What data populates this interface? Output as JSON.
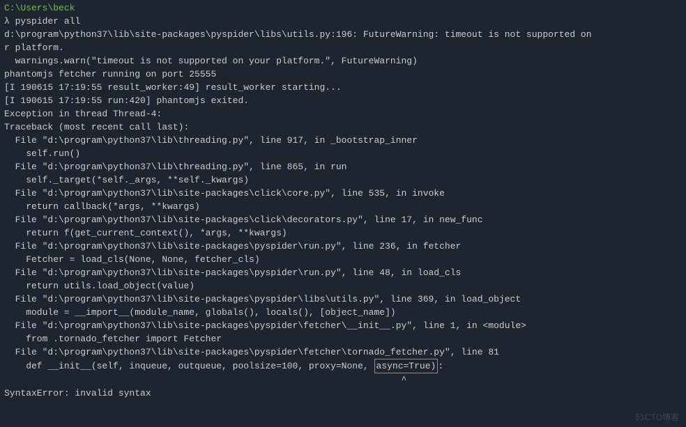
{
  "prompt": {
    "path": "C:\\Users\\beck",
    "lambda": "λ",
    "command": "pyspider all"
  },
  "lines": {
    "l1": "d:\\program\\python37\\lib\\site-packages\\pyspider\\libs\\utils.py:196: FutureWarning: timeout is not supported on",
    "l2": "r platform.",
    "l3": "  warnings.warn(\"timeout is not supported on your platform.\", FutureWarning)",
    "l4": "phantomjs fetcher running on port 25555",
    "l5": "[I 190615 17:19:55 result_worker:49] result_worker starting...",
    "l6": "[I 190615 17:19:55 run:420] phantomjs exited.",
    "l7": "Exception in thread Thread-4:",
    "l8": "Traceback (most recent call last):",
    "l9": "  File \"d:\\program\\python37\\lib\\threading.py\", line 917, in _bootstrap_inner",
    "l10": "    self.run()",
    "l11": "  File \"d:\\program\\python37\\lib\\threading.py\", line 865, in run",
    "l12": "    self._target(*self._args, **self._kwargs)",
    "l13": "  File \"d:\\program\\python37\\lib\\site-packages\\click\\core.py\", line 535, in invoke",
    "l14": "    return callback(*args, **kwargs)",
    "l15": "  File \"d:\\program\\python37\\lib\\site-packages\\click\\decorators.py\", line 17, in new_func",
    "l16": "    return f(get_current_context(), *args, **kwargs)",
    "l17": "  File \"d:\\program\\python37\\lib\\site-packages\\pyspider\\run.py\", line 236, in fetcher",
    "l18": "    Fetcher = load_cls(None, None, fetcher_cls)",
    "l19": "  File \"d:\\program\\python37\\lib\\site-packages\\pyspider\\run.py\", line 48, in load_cls",
    "l20": "    return utils.load_object(value)",
    "l21": "  File \"d:\\program\\python37\\lib\\site-packages\\pyspider\\libs\\utils.py\", line 369, in load_object",
    "l22": "    module = __import__(module_name, globals(), locals(), [object_name])",
    "l23": "  File \"d:\\program\\python37\\lib\\site-packages\\pyspider\\fetcher\\__init__.py\", line 1, in <module>",
    "l24": "    from .tornado_fetcher import Fetcher",
    "l25": "  File \"d:\\program\\python37\\lib\\site-packages\\pyspider\\fetcher\\tornado_fetcher.py\", line 81",
    "l26a": "    def __init__(self, inqueue, outqueue, poolsize=100, proxy=None, ",
    "l26b": "async=True)",
    "l26c": ":",
    "l27": "                                                                         ^",
    "l28": "SyntaxError: invalid syntax"
  },
  "watermark": "51CTO博客"
}
